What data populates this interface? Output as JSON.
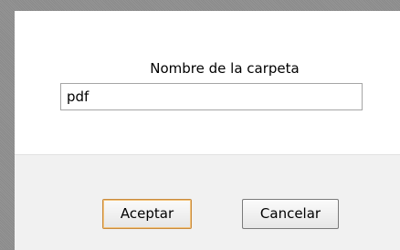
{
  "dialog": {
    "field_label": "Nombre de la carpeta",
    "field_value": "pdf",
    "accept_label": "Aceptar",
    "cancel_label": "Cancelar"
  }
}
